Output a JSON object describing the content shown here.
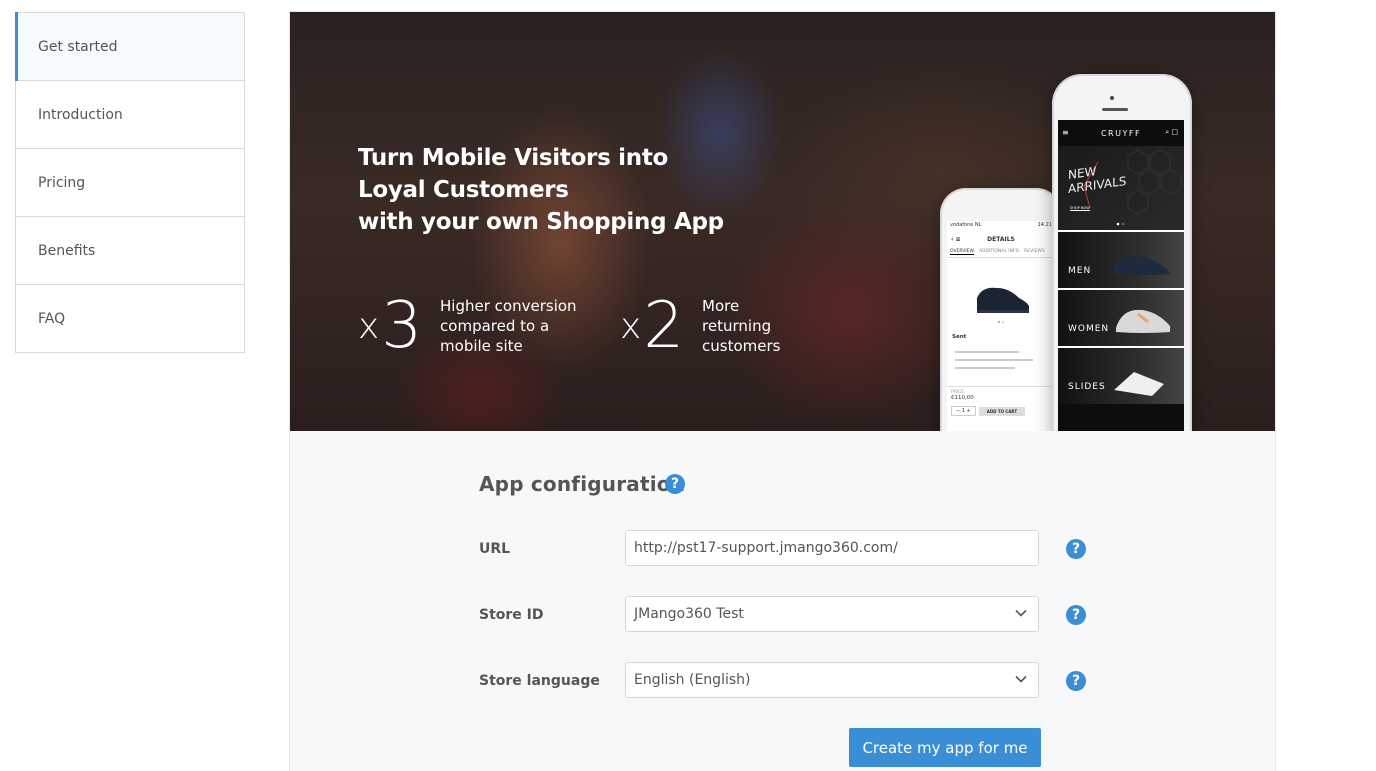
{
  "sidebar": {
    "items": [
      {
        "label": "Get started",
        "active": true
      },
      {
        "label": "Introduction"
      },
      {
        "label": "Pricing"
      },
      {
        "label": "Benefits"
      },
      {
        "label": "FAQ"
      }
    ]
  },
  "hero": {
    "title_lines": [
      "Turn Mobile Visitors into",
      "Loyal Customers",
      "with your own Shopping App"
    ],
    "stats": [
      {
        "multiplier": "x",
        "value": "3",
        "text_lines": [
          "Higher conversion",
          "compared to a",
          "mobile site"
        ]
      },
      {
        "multiplier": "x",
        "value": "2",
        "text_lines": [
          "More",
          "returning",
          "customers"
        ]
      }
    ],
    "phone_small": {
      "status_carrier": "vodafone NL",
      "status_time": "14:21",
      "header": "DETAILS",
      "tabs": [
        "OVERVIEW",
        "ADDITIONAL INFO",
        "REVIEWS"
      ],
      "product_name": "Sent",
      "price_label": "PRICE",
      "price": "€110,00",
      "qty": "1",
      "add_to_cart": "ADD TO CART"
    },
    "phone_big": {
      "brand": "CRUYFF",
      "banner": [
        "NEW",
        "ARRIVALS"
      ],
      "banner_cta": "SHOP NOW",
      "categories": [
        "MEN",
        "WOMEN",
        "SLIDES"
      ]
    }
  },
  "form": {
    "title": "App configuration",
    "url_label": "URL",
    "url_value": "http://pst17-support.jmango360.com/",
    "store_id_label": "Store ID",
    "store_id_value": "JMango360 Test",
    "store_language_label": "Store language",
    "store_language_value": "English (English)",
    "submit_label": "Create my app for me",
    "help_glyph": "?"
  },
  "colors": {
    "accent": "#3a8ed6",
    "panel_bg": "#f7f8fa",
    "border": "#d9d9d9"
  }
}
